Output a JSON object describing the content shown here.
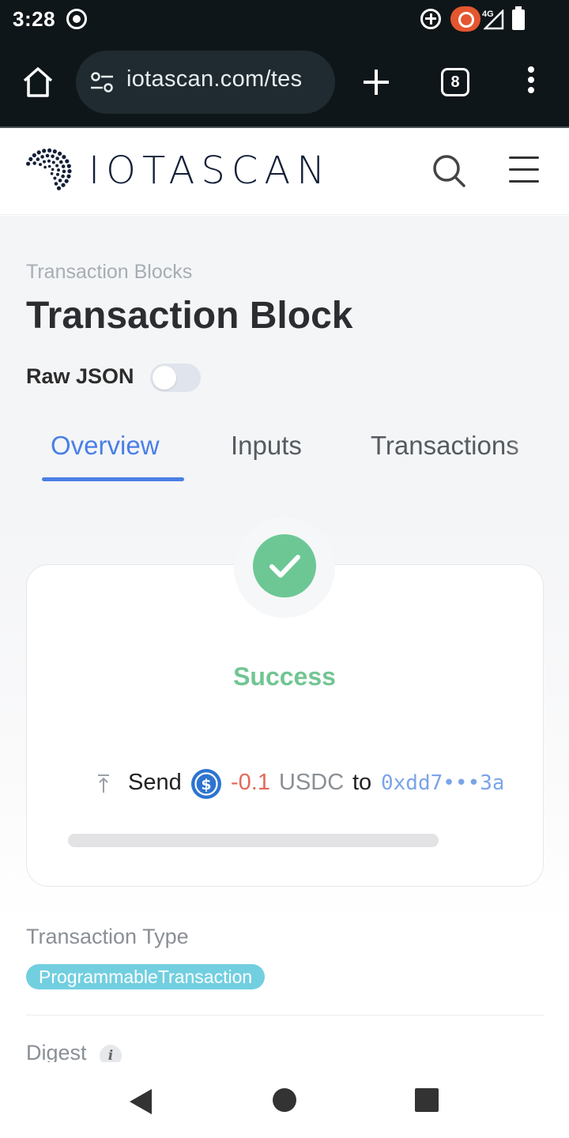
{
  "status_bar": {
    "time": "3:28",
    "network": "4G",
    "icons": [
      "screen-record-icon",
      "sync-icon",
      "recording-pill-icon",
      "signal-icon",
      "battery-icon"
    ]
  },
  "browser": {
    "url": "iotascan.com/tes",
    "tab_count": "8",
    "icons": [
      "home-icon",
      "site-settings-icon",
      "plus-icon",
      "more-vert-icon"
    ]
  },
  "header": {
    "logo_text": "IOTASCAN",
    "icons": [
      "iota-logo-icon",
      "search-icon",
      "hamburger-menu-icon"
    ]
  },
  "page": {
    "breadcrumb": "Transaction Blocks",
    "title": "Transaction Block",
    "raw_json_label": "Raw JSON",
    "raw_json_enabled": false
  },
  "tabs": {
    "active": "Overview",
    "items": [
      "Overview",
      "Inputs",
      "Transactions"
    ]
  },
  "status_card": {
    "status": "Success",
    "send_label": "Send",
    "amount": "-0.1",
    "token": "USDC",
    "to_label": "to",
    "address": "0xdd7•••3a",
    "colors": {
      "success": "#6cc795",
      "amount": "#e2695b",
      "address": "#7aa4e8"
    }
  },
  "details": {
    "transaction_type_label": "Transaction Type",
    "transaction_type": "ProgrammableTransaction",
    "digest_label": "Digest",
    "info_glyph": "i"
  },
  "accent_color": "#4a7fe6"
}
